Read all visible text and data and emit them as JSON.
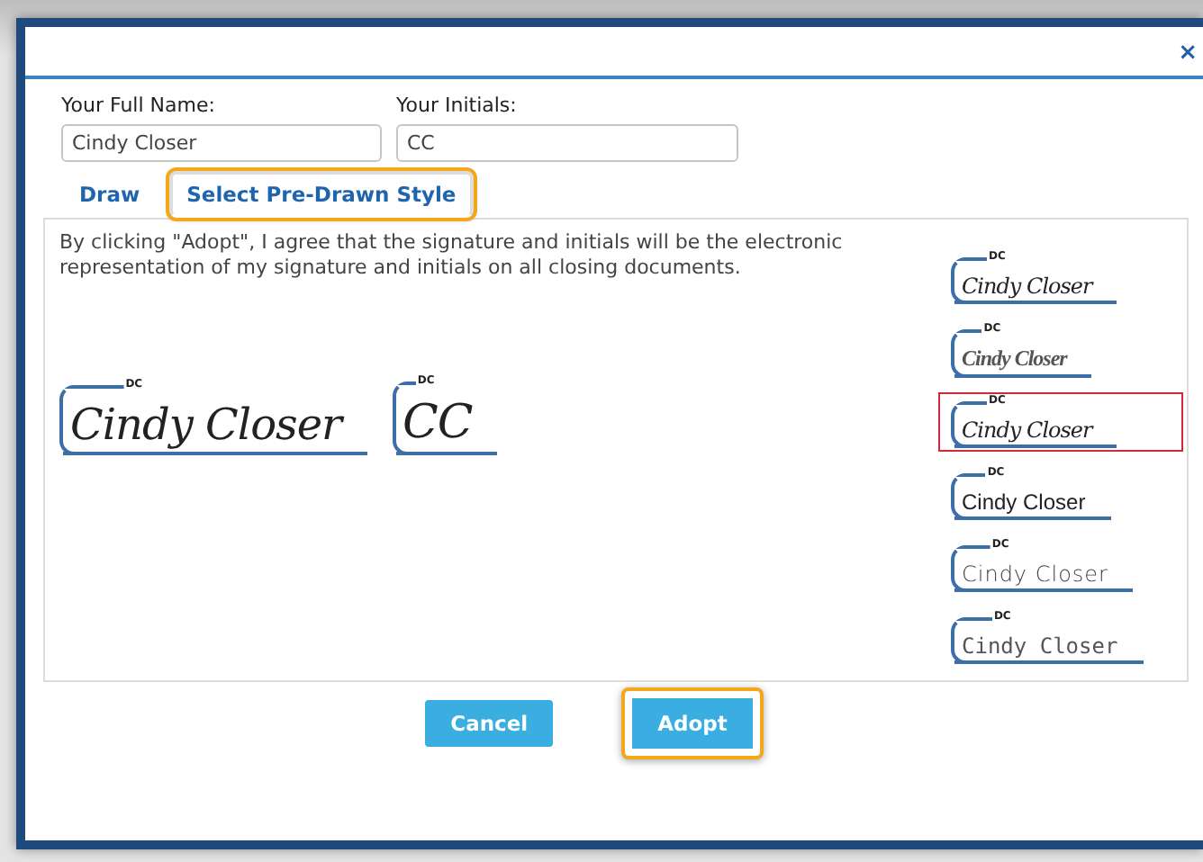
{
  "dialog": {
    "close": "×"
  },
  "fields": [
    {
      "label": "Your Full Name:",
      "value": "Cindy Closer"
    },
    {
      "label": "Your Initials:",
      "value": "CC"
    }
  ],
  "tabs": [
    {
      "label": "Draw",
      "selected": false,
      "focused": false
    },
    {
      "label": "Select Pre-Drawn Style",
      "selected": true,
      "focused": true
    }
  ],
  "notice": "By clicking \"Adopt\", I agree that the signature and initials will be the electronic representation of my signature and initials on all closing documents.",
  "preview": [
    {
      "tag": "DC",
      "text": "Cindy Closer"
    },
    {
      "tag": "DC",
      "text": "CC"
    }
  ],
  "styles": [
    {
      "tag": "DC",
      "text": "Cindy Closer",
      "selected": false
    },
    {
      "tag": "DC",
      "text": "Cindy Closer",
      "selected": false
    },
    {
      "tag": "DC",
      "text": "Cindy Closer",
      "selected": true
    },
    {
      "tag": "DC",
      "text": "Cindy Closer",
      "selected": false
    },
    {
      "tag": "DC",
      "text": "Cindy Closer",
      "selected": false
    },
    {
      "tag": "DC",
      "text": "Cindy Closer",
      "selected": false
    }
  ],
  "buttons": [
    {
      "label": "Cancel",
      "focused": false
    },
    {
      "label": "Adopt",
      "focused": true
    }
  ]
}
